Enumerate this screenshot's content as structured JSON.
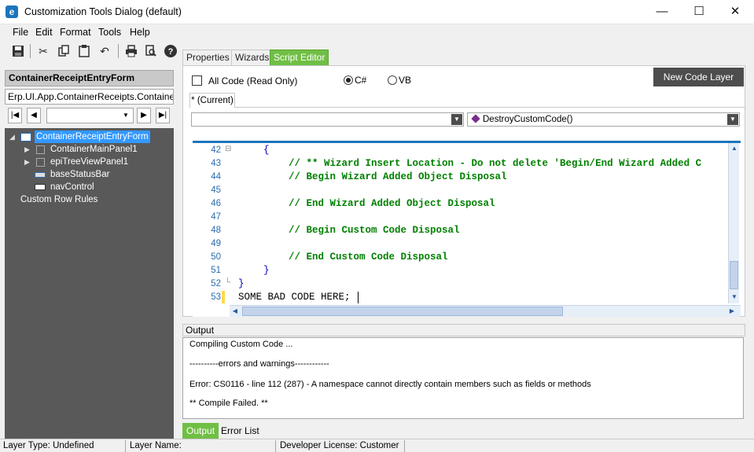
{
  "window": {
    "title": "Customization Tools Dialog (default)",
    "app_icon_letter": "e",
    "minimize": "—",
    "maximize": "☐",
    "close": "✕"
  },
  "menu": [
    "File",
    "Edit",
    "Format",
    "Tools",
    "Help"
  ],
  "toolbar_icons": [
    "save-icon",
    "cut-icon",
    "copy-icon",
    "paste-icon",
    "undo-icon",
    "print-icon",
    "print-preview-icon",
    "help-icon"
  ],
  "left": {
    "form_name": "ContainerReceiptEntryForm",
    "namespace": "Erp.UI.App.ContainerReceipts.Container",
    "tree": [
      {
        "label": "ContainerReceiptEntryForm",
        "selected": true
      },
      {
        "label": "ContainerMainPanel1"
      },
      {
        "label": "epiTreeViewPanel1"
      },
      {
        "label": "baseStatusBar"
      },
      {
        "label": "navControl"
      },
      {
        "label": "Custom Row Rules"
      }
    ]
  },
  "tabs": [
    "Properties",
    "Wizards",
    "Script Editor"
  ],
  "editor_header": {
    "all_code_label": "All Code (Read Only)",
    "lang_cs": "C#",
    "lang_vb": "VB",
    "new_layer": "New Code Layer",
    "current_tab": "* (Current)",
    "method_combo": "DestroyCustomCode()"
  },
  "code": {
    "lines": [
      {
        "n": "42",
        "text": "{",
        "kind": "brace",
        "indent": 4
      },
      {
        "n": "43",
        "text": "// ** Wizard Insert Location - Do not delete 'Begin/End Wizard Added C",
        "kind": "comment",
        "indent": 8
      },
      {
        "n": "44",
        "text": "// Begin Wizard Added Object Disposal",
        "kind": "comment",
        "indent": 8
      },
      {
        "n": "45",
        "text": "",
        "kind": "plain",
        "indent": 0
      },
      {
        "n": "46",
        "text": "// End Wizard Added Object Disposal",
        "kind": "comment",
        "indent": 8
      },
      {
        "n": "47",
        "text": "",
        "kind": "plain",
        "indent": 0
      },
      {
        "n": "48",
        "text": "// Begin Custom Code Disposal",
        "kind": "comment",
        "indent": 8
      },
      {
        "n": "49",
        "text": "",
        "kind": "plain",
        "indent": 0
      },
      {
        "n": "50",
        "text": "// End Custom Code Disposal",
        "kind": "comment",
        "indent": 8
      },
      {
        "n": "51",
        "text": "}",
        "kind": "brace",
        "indent": 4
      },
      {
        "n": "52",
        "text": "}",
        "kind": "brace",
        "indent": 0
      },
      {
        "n": "53",
        "text": "SOME BAD CODE HERE;",
        "kind": "plain",
        "indent": 0
      }
    ]
  },
  "output": {
    "label": "Output",
    "lines": [
      "Compiling Custom Code ...",
      "----------errors and warnings------------",
      "Error: CS0116 - line 112 (287) - A namespace cannot directly contain members such as fields or methods",
      "** Compile Failed. **"
    ],
    "tabs": [
      "Output",
      "Error List"
    ]
  },
  "status": {
    "layer_type": "Layer Type:  Undefined",
    "layer_name": "Layer Name:",
    "license": "Developer License:  Customer"
  },
  "colors": {
    "accent_green": "#70bf44",
    "tree_bg": "#595959",
    "selection_blue": "#3399ff",
    "comment_green": "#008000"
  }
}
